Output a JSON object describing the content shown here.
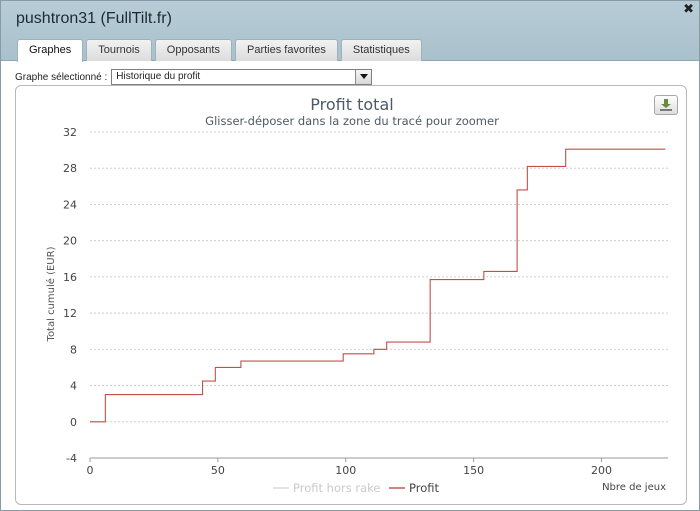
{
  "window": {
    "title": "pushtron31 (FullTilt.fr)",
    "close_glyph": "✖"
  },
  "tabs": [
    {
      "label": "Graphes",
      "active": true
    },
    {
      "label": "Tournois",
      "active": false
    },
    {
      "label": "Opposants",
      "active": false
    },
    {
      "label": "Parties favorites",
      "active": false
    },
    {
      "label": "Statistiques",
      "active": false
    }
  ],
  "graph_selector": {
    "label": "Graphe sélectionné :",
    "value": "Historique du profit"
  },
  "colors": {
    "profit": "#c0504d",
    "profit_hors_rake": "#d9d9d9",
    "title": "#4d5a66",
    "grid": "#cfcfcf"
  },
  "icons": {
    "export": "download-icon",
    "dropdown": "triangle-down-icon",
    "close": "close-icon"
  },
  "chart_data": {
    "type": "line",
    "title": "Profit total",
    "subtitle": "Glisser-déposer dans la zone du tracé pour zoomer",
    "xlabel": "Nbre de jeux",
    "ylabel": "Total cumulé (EUR)",
    "xlim": [
      0,
      226
    ],
    "ylim": [
      -4,
      32
    ],
    "xticks": [
      0,
      50,
      100,
      150,
      200
    ],
    "yticks": [
      -4,
      0,
      4,
      8,
      12,
      16,
      20,
      24,
      28,
      32
    ],
    "grid": true,
    "legend": "bottom",
    "series": [
      {
        "name": "Profit hors rake",
        "visible": false,
        "step": true,
        "x": [],
        "y": []
      },
      {
        "name": "Profit",
        "visible": true,
        "step": true,
        "x": [
          0,
          4,
          6,
          44,
          49,
          59,
          99,
          111,
          116,
          133,
          154,
          167,
          171,
          186,
          225
        ],
        "y": [
          0,
          0,
          3,
          4.5,
          6,
          6.7,
          7.5,
          8,
          8.8,
          15.7,
          16.6,
          25.6,
          28.2,
          30.1,
          30.1
        ]
      }
    ]
  }
}
